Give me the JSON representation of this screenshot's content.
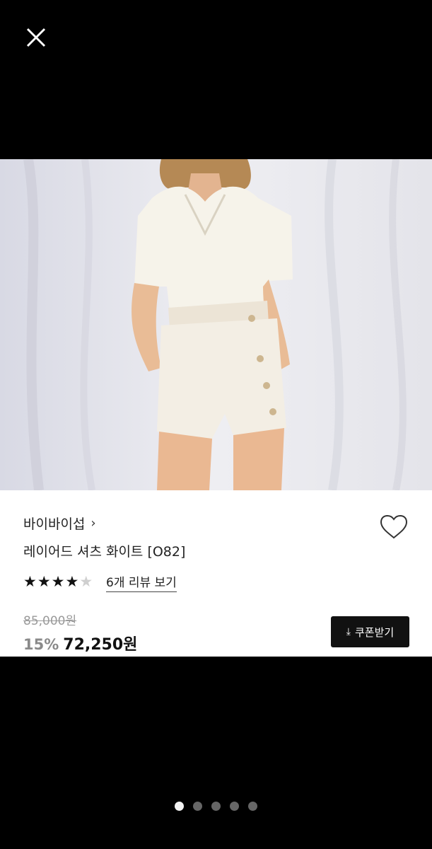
{
  "icons": {
    "close": "close-icon",
    "heart": "heart-icon",
    "chevron": "chevron-right-icon",
    "download": "download-icon"
  },
  "product": {
    "brand": "바이바이섭",
    "brand_chevron": "›",
    "name": "레이어드 셔츠 화이트 [O82]",
    "rating": {
      "filled": 4,
      "total": 5
    },
    "review_link": "6개 리뷰 보기",
    "original_price": "85,000원",
    "discount": "15%",
    "price": "72,250원"
  },
  "coupon": {
    "icon": "⤓",
    "label": "쿠폰받기"
  },
  "carousel": {
    "count": 5,
    "active": 0
  },
  "colors": {
    "background": "#000000",
    "card": "#ffffff",
    "button": "#111111",
    "star_on": "#111111",
    "star_off": "#cfcfcf"
  }
}
